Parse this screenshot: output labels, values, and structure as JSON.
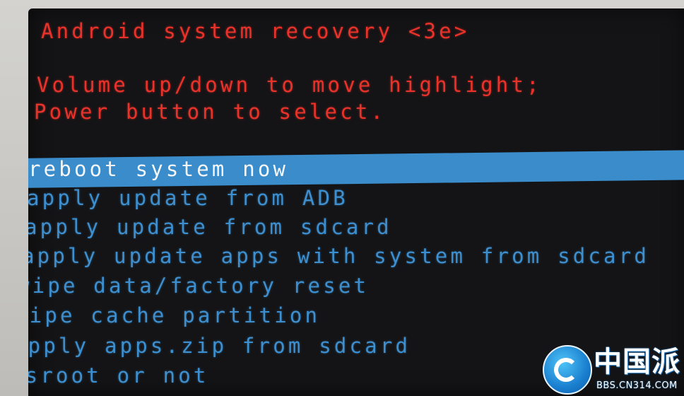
{
  "header": {
    "title": "Android system recovery <3e>",
    "instruction_1": "Volume up/down to move highlight;",
    "instruction_2": "Power button to select."
  },
  "menu": {
    "items": [
      {
        "label": "reboot system now",
        "selected": true
      },
      {
        "label": "apply update from ADB",
        "selected": false
      },
      {
        "label": "apply update from sdcard",
        "selected": false
      },
      {
        "label": "apply update apps with system from sdcard",
        "selected": false
      },
      {
        "label": "wipe data/factory reset",
        "selected": false
      },
      {
        "label": "wipe cache partition",
        "selected": false
      },
      {
        "label": "apply apps.zip from sdcard",
        "selected": false
      },
      {
        "label": "isroot or not",
        "selected": false
      }
    ]
  },
  "watermark": {
    "name": "中国派",
    "url": "BBS.CN314.COM",
    "icon": "cn314-logo-icon"
  },
  "colors": {
    "header_text": "#e8322a",
    "menu_text": "#3d8fcf",
    "highlight": "#3a8ccb",
    "selected_text": "#f4f6f8",
    "screen_bg": "#141416"
  }
}
